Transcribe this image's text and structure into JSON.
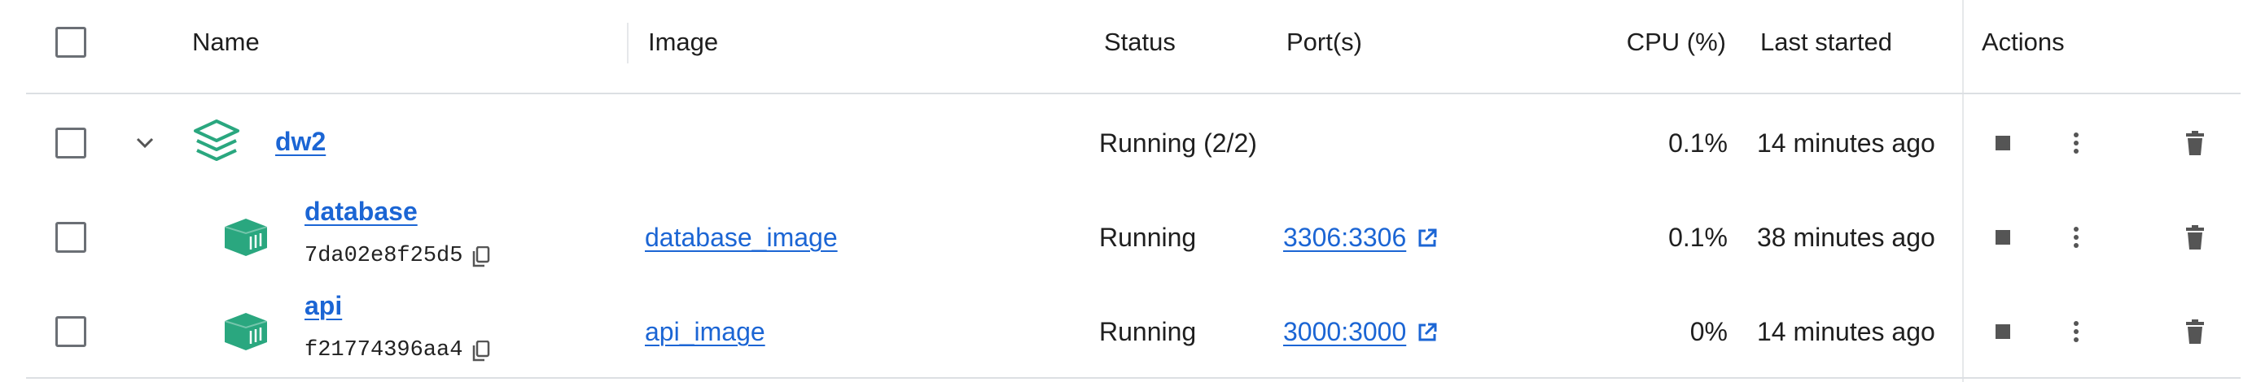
{
  "table": {
    "headers": {
      "name": "Name",
      "image": "Image",
      "status": "Status",
      "ports": "Port(s)",
      "cpu": "CPU (%)",
      "last_started": "Last started",
      "actions": "Actions"
    },
    "group": {
      "name": "dw2",
      "status": "Running (2/2)",
      "cpu": "0.1%",
      "last_started": "14 minutes ago"
    },
    "rows": [
      {
        "name": "database",
        "id": "7da02e8f25d5",
        "image": "database_image",
        "status": "Running",
        "ports": "3306:3306",
        "cpu": "0.1%",
        "last_started": "38 minutes ago"
      },
      {
        "name": "api",
        "id": "f21774396aa4",
        "image": "api_image",
        "status": "Running",
        "ports": "3000:3000",
        "cpu": "0%",
        "last_started": "14 minutes ago"
      }
    ]
  },
  "icons": {
    "stack": "stack-icon",
    "container": "container-icon",
    "copy": "copy-icon",
    "external": "external-link-icon",
    "stop": "stop-icon",
    "more": "more-vertical-icon",
    "delete": "trash-icon",
    "chevron": "chevron-down-icon"
  },
  "colors": {
    "link": "#1b65d4",
    "container_icon": "#2aa77f",
    "stack_icon": "#2aa77f"
  }
}
